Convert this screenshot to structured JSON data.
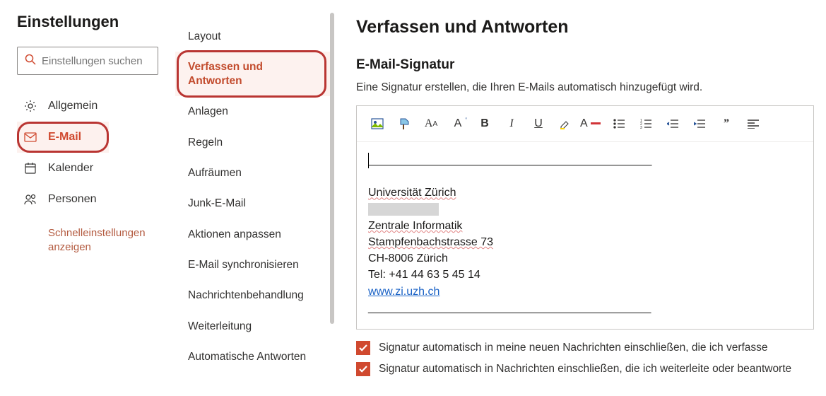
{
  "panel_title": "Einstellungen",
  "search": {
    "placeholder": "Einstellungen suchen"
  },
  "primary_nav": {
    "general": "Allgemein",
    "email": "E-Mail",
    "calendar": "Kalender",
    "people": "Personen"
  },
  "quick_settings": "Schnelleinstellungen anzeigen",
  "sub_nav": {
    "items": [
      "Layout",
      "Verfassen und Antworten",
      "Anlagen",
      "Regeln",
      "Aufräumen",
      "Junk-E-Mail",
      "Aktionen anpassen",
      "E-Mail synchronisieren",
      "Nachrichtenbehandlung",
      "Weiterleitung",
      "Automatische Antworten"
    ],
    "selected": 1
  },
  "main": {
    "title": "Verfassen und Antworten",
    "section": "E-Mail-Signatur",
    "description": "Eine Signatur erstellen, die Ihren E-Mails automatisch hinzugefügt wird.",
    "signature": {
      "org": "Universität Zürich",
      "dept": "Zentrale Informatik",
      "street": "Stampfenbachstrasse 73",
      "city": "CH-8006 Zürich",
      "tel": "Tel: +41 44 63 5 45 14",
      "url": "www.zi.uzh.ch"
    },
    "checks": {
      "new": "Signatur automatisch in meine neuen Nachrichten einschließen, die ich verfasse",
      "fwd": "Signatur automatisch in Nachrichten einschließen, die ich weiterleite oder beantworte"
    }
  },
  "icons": {
    "search": "search-icon",
    "gear": "gear-icon",
    "mail": "mail-icon",
    "calendar": "calendar-icon",
    "people": "people-icon"
  }
}
